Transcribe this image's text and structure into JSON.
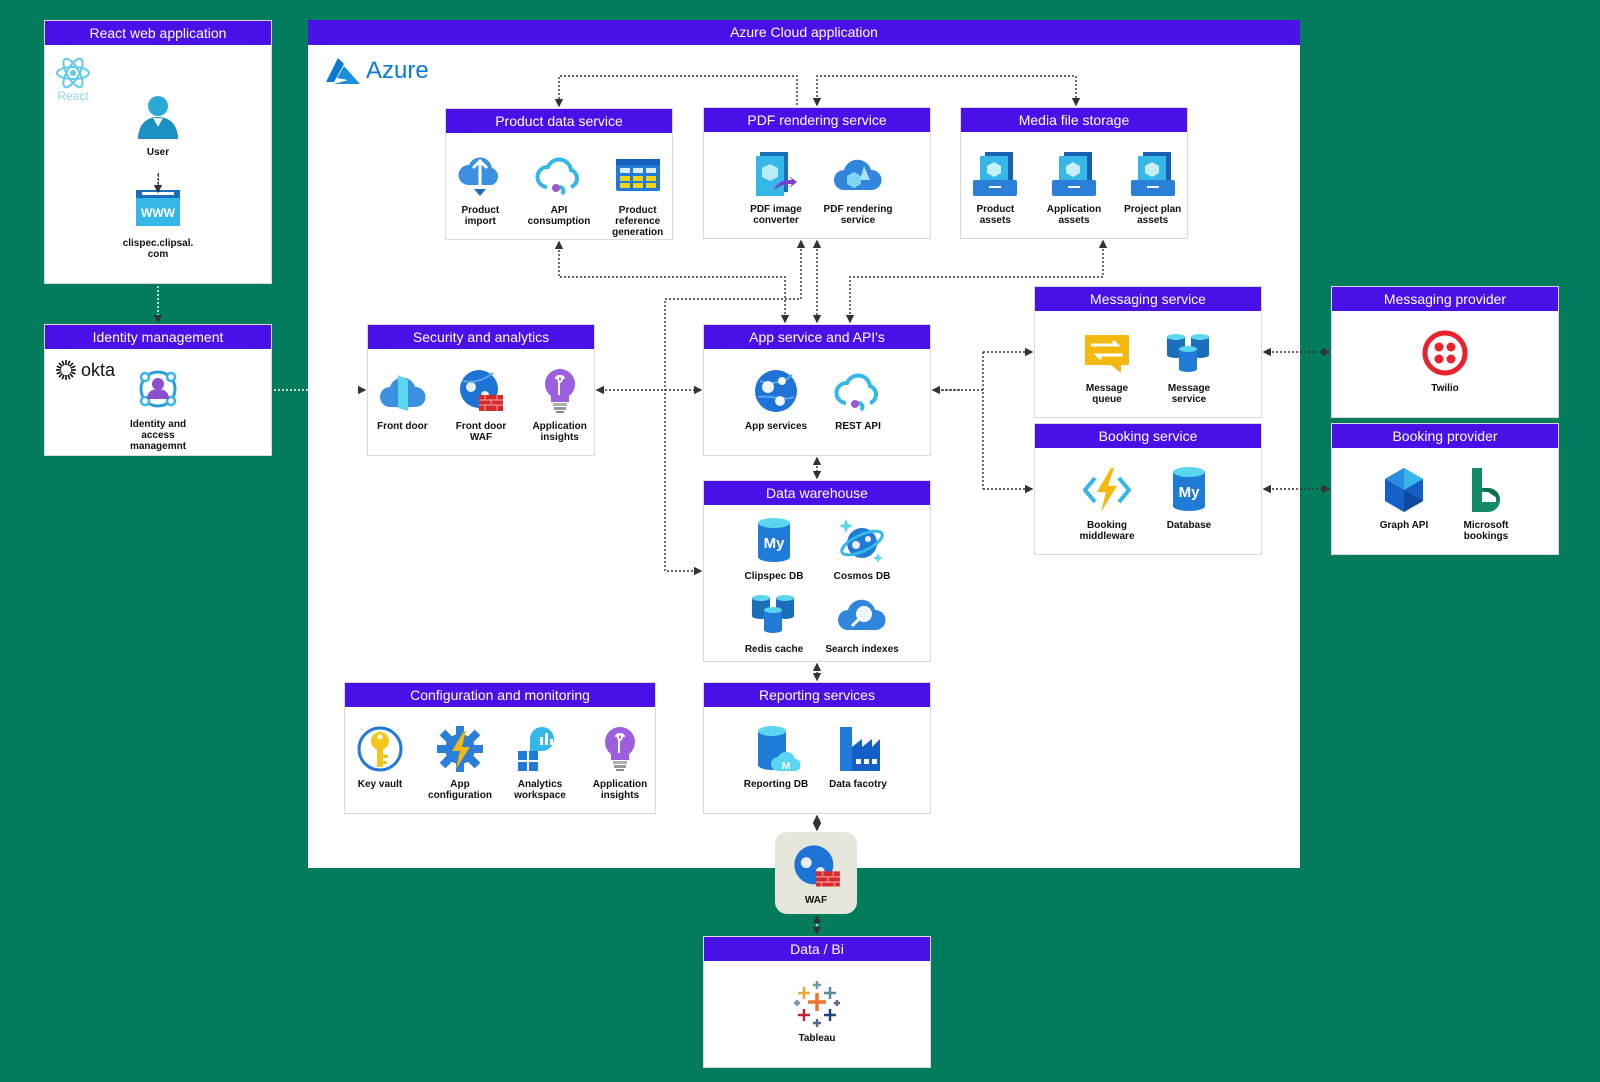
{
  "colors": {
    "background": "#037c5e",
    "header": "#4a10e8",
    "panel": "#ffffff",
    "waf_bg": "#e7e6da"
  },
  "react": {
    "title": "React web application",
    "logo": "React",
    "items": [
      {
        "icon": "user-icon",
        "label": "User"
      },
      {
        "icon": "www-icon",
        "label": "clispec.clipsal.\ncom"
      }
    ]
  },
  "identity": {
    "title": "Identity management",
    "logo": "okta",
    "items": [
      {
        "icon": "identity-access-icon",
        "label": "Identity and access\nmanagemnt"
      }
    ]
  },
  "azure": {
    "title": "Azure Cloud application",
    "logo": "Azure"
  },
  "product_data": {
    "title": "Product data service",
    "items": [
      {
        "icon": "cloud-upload-icon",
        "label": "Product\nimport"
      },
      {
        "icon": "api-cloud-icon",
        "label": "API\nconsumption"
      },
      {
        "icon": "table-grid-icon",
        "label": "Product\nreference\ngeneration"
      }
    ]
  },
  "pdf": {
    "title": "PDF rendering service",
    "items": [
      {
        "icon": "pdf-converter-icon",
        "label": "PDF image\nconverter"
      },
      {
        "icon": "cloud-cube-icon",
        "label": "PDF rendering\nservice"
      }
    ]
  },
  "media": {
    "title": "Media file storage",
    "items": [
      {
        "icon": "storage-icon",
        "label": "Product\nassets"
      },
      {
        "icon": "storage-icon",
        "label": "Application\nassets"
      },
      {
        "icon": "storage-icon",
        "label": "Project plan\nassets"
      }
    ]
  },
  "security": {
    "title": "Security and analytics",
    "items": [
      {
        "icon": "front-door-icon",
        "label": "Front door"
      },
      {
        "icon": "waf-globe-icon",
        "label": "Front door\nWAF"
      },
      {
        "icon": "lightbulb-icon",
        "label": "Application\ninsights"
      }
    ]
  },
  "appservice": {
    "title": "App service and API's",
    "items": [
      {
        "icon": "app-services-icon",
        "label": "App services"
      },
      {
        "icon": "api-cloud-icon",
        "label": "REST API"
      }
    ]
  },
  "messaging": {
    "title": "Messaging service",
    "items": [
      {
        "icon": "message-queue-icon",
        "label": "Message\nqueue"
      },
      {
        "icon": "cylinders-icon",
        "label": "Message\nservice"
      }
    ]
  },
  "booking": {
    "title": "Booking service",
    "items": [
      {
        "icon": "function-bolt-icon",
        "label": "Booking\nmiddleware"
      },
      {
        "icon": "mysql-db-icon",
        "label": "Database"
      }
    ]
  },
  "msg_provider": {
    "title": "Messaging provider",
    "items": [
      {
        "icon": "twilio-icon",
        "label": "Twilio"
      }
    ]
  },
  "book_provider": {
    "title": "Booking provider",
    "items": [
      {
        "icon": "graph-api-icon",
        "label": "Graph API"
      },
      {
        "icon": "bookings-icon",
        "label": "Microsoft\nbookings"
      }
    ]
  },
  "warehouse": {
    "title": "Data warehouse",
    "items": [
      {
        "icon": "mysql-db-icon",
        "label": "Clipspec DB"
      },
      {
        "icon": "cosmos-db-icon",
        "label": "Cosmos DB"
      },
      {
        "icon": "cylinders-icon",
        "label": "Redis cache"
      },
      {
        "icon": "search-cloud-icon",
        "label": "Search indexes"
      }
    ]
  },
  "config": {
    "title": "Configuration and monitoring",
    "items": [
      {
        "icon": "key-vault-icon",
        "label": "Key vault"
      },
      {
        "icon": "gear-bolt-icon",
        "label": "App\nconfiguration"
      },
      {
        "icon": "analytics-icon",
        "label": "Analytics\nworkspace"
      },
      {
        "icon": "lightbulb-icon",
        "label": "Application\ninsights"
      }
    ]
  },
  "reporting": {
    "title": "Reporting services",
    "items": [
      {
        "icon": "reporting-db-icon",
        "label": "Reporting DB"
      },
      {
        "icon": "factory-icon",
        "label": "Data facotry"
      }
    ]
  },
  "waf": {
    "label": "WAF"
  },
  "databi": {
    "title": "Data / Bi",
    "items": [
      {
        "icon": "tableau-icon",
        "label": "Tableau"
      }
    ]
  }
}
